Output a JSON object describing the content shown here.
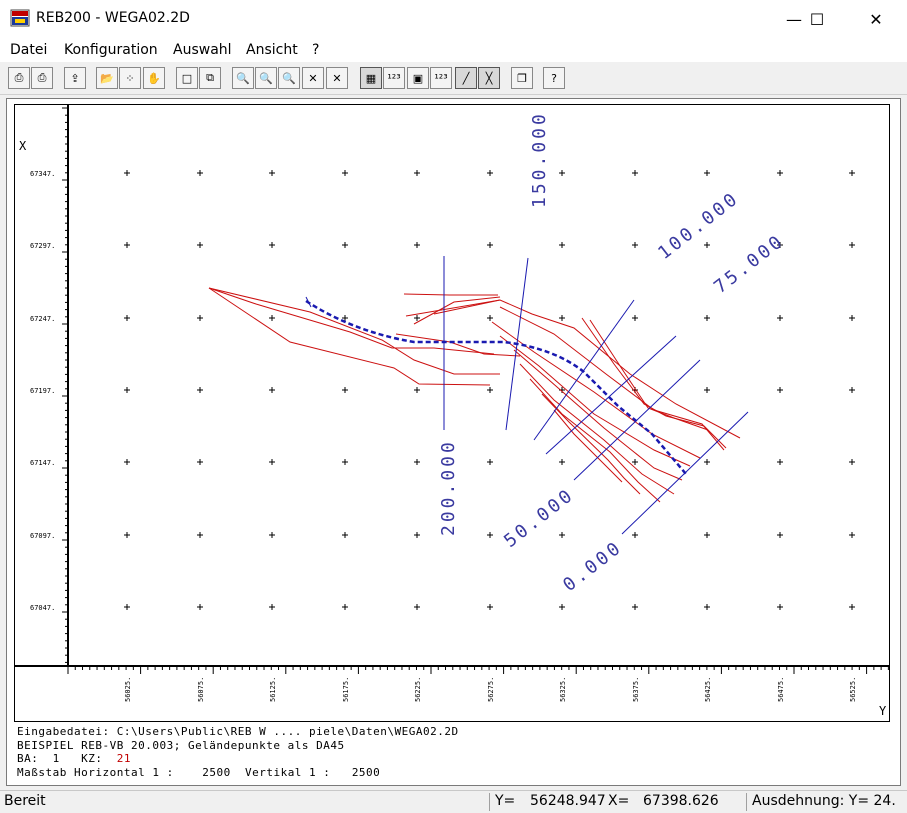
{
  "window": {
    "title": "REB200 - WEGA02.2D",
    "minimize_glyph": "—",
    "maximize_glyph": "☐",
    "close_glyph": "✕"
  },
  "menu": [
    "Datei",
    "Konfiguration",
    "Auswahl",
    "Ansicht",
    "?"
  ],
  "toolbar": {
    "buttons": [
      {
        "name": "print-icon",
        "glyph": "⎙"
      },
      {
        "name": "print-setup-icon",
        "glyph": "⎙"
      },
      {
        "name": "export-icon",
        "glyph": "⇪"
      },
      {
        "name": "open-folder-icon",
        "glyph": "📂"
      },
      {
        "name": "points-icon",
        "glyph": "⁘"
      },
      {
        "name": "hand-icon",
        "glyph": "✋"
      },
      {
        "name": "rectangle-icon",
        "glyph": "□"
      },
      {
        "name": "zoom-window-icon",
        "glyph": "⧉"
      },
      {
        "name": "zoom-m-icon",
        "glyph": "🔍"
      },
      {
        "name": "zoom-f-icon",
        "glyph": "🔍"
      },
      {
        "name": "zoom-v-icon",
        "glyph": "🔍"
      },
      {
        "name": "zoom-extents-icon",
        "glyph": "✕"
      },
      {
        "name": "zoom-center-icon",
        "glyph": "✕"
      },
      {
        "name": "grid-icon",
        "glyph": "▦"
      },
      {
        "name": "numbering-icon",
        "glyph": "¹²³"
      },
      {
        "name": "point-box-icon",
        "glyph": "▣"
      },
      {
        "name": "renumber-icon",
        "glyph": "¹²³"
      },
      {
        "name": "line-icon",
        "glyph": "╱"
      },
      {
        "name": "cross-line-icon",
        "glyph": "╳"
      },
      {
        "name": "layers-icon",
        "glyph": "❐"
      },
      {
        "name": "help-icon",
        "glyph": "?"
      }
    ]
  },
  "plot": {
    "x_axis_label": "X",
    "y_axis_label": "Y",
    "x_ticks": [
      "67347.",
      "67297.",
      "67247.",
      "67197.",
      "67147.",
      "67097.",
      "67047."
    ],
    "y_ticks": [
      "56025.",
      "56075.",
      "56125.",
      "56175.",
      "56225.",
      "56275.",
      "56325.",
      "56375.",
      "56425.",
      "56475.",
      "56525."
    ],
    "station_labels": [
      "150.000",
      "100.000",
      "75.000",
      "200.000",
      "50.000",
      "0.000"
    ],
    "colors": {
      "profiles": "#cc1111",
      "axis_line": "#1a1ab0",
      "text_blue": "#3a3aa0",
      "frame": "#000000"
    }
  },
  "info": {
    "line1": "Eingabedatei: C:\\Users\\Public\\REB W .... piele\\Daten\\WEGA02.2D",
    "line2": "BEISPIEL REB-VB 20.003; Geländepunkte als DA45",
    "ba_label": "BA:",
    "ba_value": "1",
    "kz_label": "KZ:",
    "kz_value": "21",
    "scale_h_label": "Maßstab Horizontal 1 :",
    "scale_h_value": "2500",
    "scale_v_label": "Vertikal 1 :",
    "scale_v_value": "2500"
  },
  "status": {
    "state": "Bereit",
    "y_label": "Y=",
    "y_value": "56248.947",
    "x_label": "X=",
    "x_value": "67398.626",
    "extent": "Ausdehnung: Y= 24."
  }
}
